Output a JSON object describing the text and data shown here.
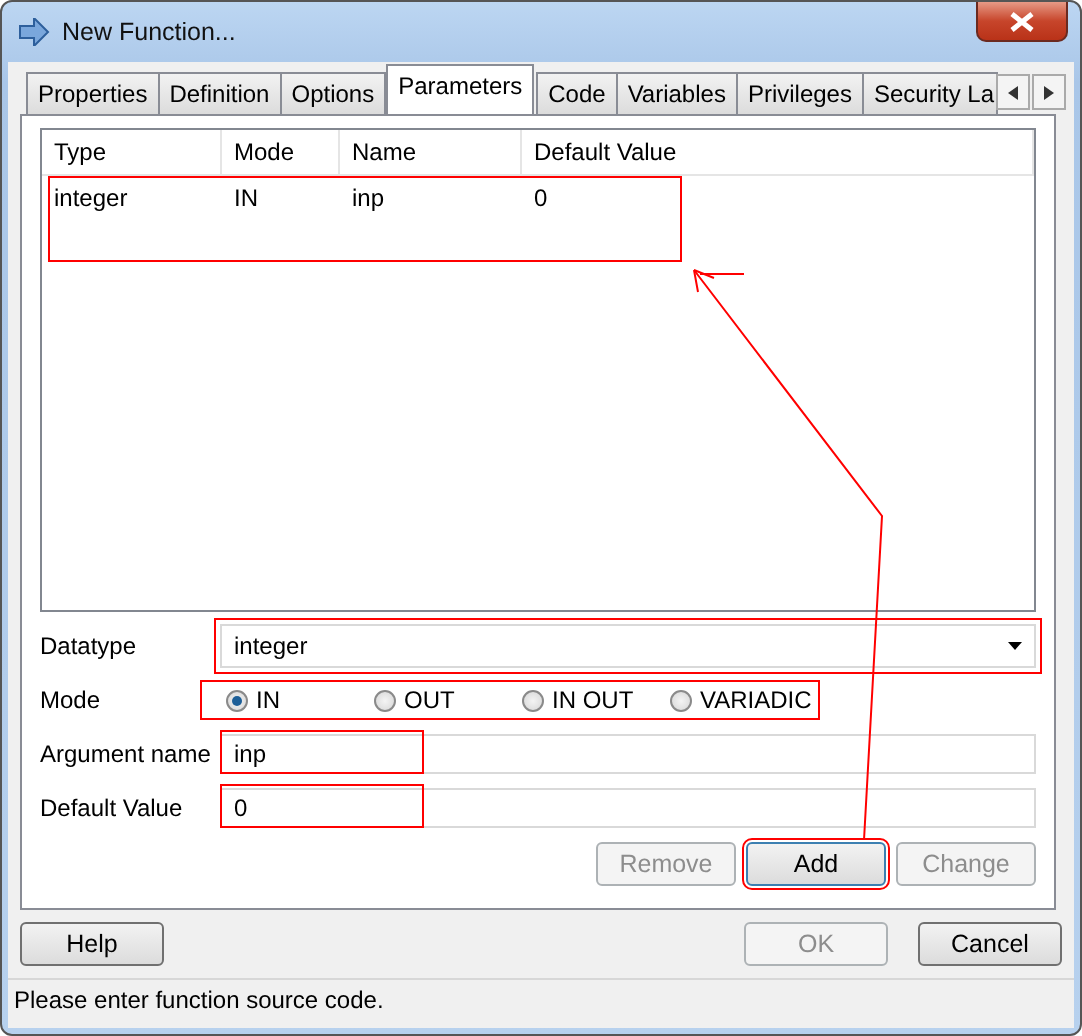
{
  "window": {
    "title": "New Function..."
  },
  "tabs": [
    {
      "label": "Properties",
      "selected": false
    },
    {
      "label": "Definition",
      "selected": false
    },
    {
      "label": "Options",
      "selected": false
    },
    {
      "label": "Parameters",
      "selected": true
    },
    {
      "label": "Code",
      "selected": false
    },
    {
      "label": "Variables",
      "selected": false
    },
    {
      "label": "Privileges",
      "selected": false
    },
    {
      "label": "Security La",
      "selected": false
    }
  ],
  "parameters": {
    "columns": [
      "Type",
      "Mode",
      "Name",
      "Default Value"
    ],
    "rows": [
      {
        "cells": [
          "integer",
          "IN",
          "inp",
          "0"
        ],
        "highlighted": true
      }
    ]
  },
  "form": {
    "datatype": {
      "label": "Datatype",
      "value": "integer",
      "highlighted": true
    },
    "mode": {
      "label": "Mode",
      "highlighted": true,
      "options": [
        {
          "label": "IN",
          "selected": true
        },
        {
          "label": "OUT",
          "selected": false
        },
        {
          "label": "IN OUT",
          "selected": false
        },
        {
          "label": "VARIADIC",
          "selected": false
        }
      ]
    },
    "argument_name": {
      "label": "Argument name",
      "value": "inp",
      "highlighted": true
    },
    "default_value": {
      "label": "Default Value",
      "value": "0",
      "highlighted": true
    }
  },
  "list_buttons": [
    {
      "label": "Remove",
      "disabled": true,
      "highlighted": false
    },
    {
      "label": "Add",
      "disabled": false,
      "highlighted": true
    },
    {
      "label": "Change",
      "disabled": true,
      "highlighted": false
    }
  ],
  "dialog_buttons": [
    {
      "label": "Help",
      "disabled": false
    },
    {
      "label": "OK",
      "disabled": true
    },
    {
      "label": "Cancel",
      "disabled": false
    }
  ],
  "status_bar": "Please enter function source code."
}
